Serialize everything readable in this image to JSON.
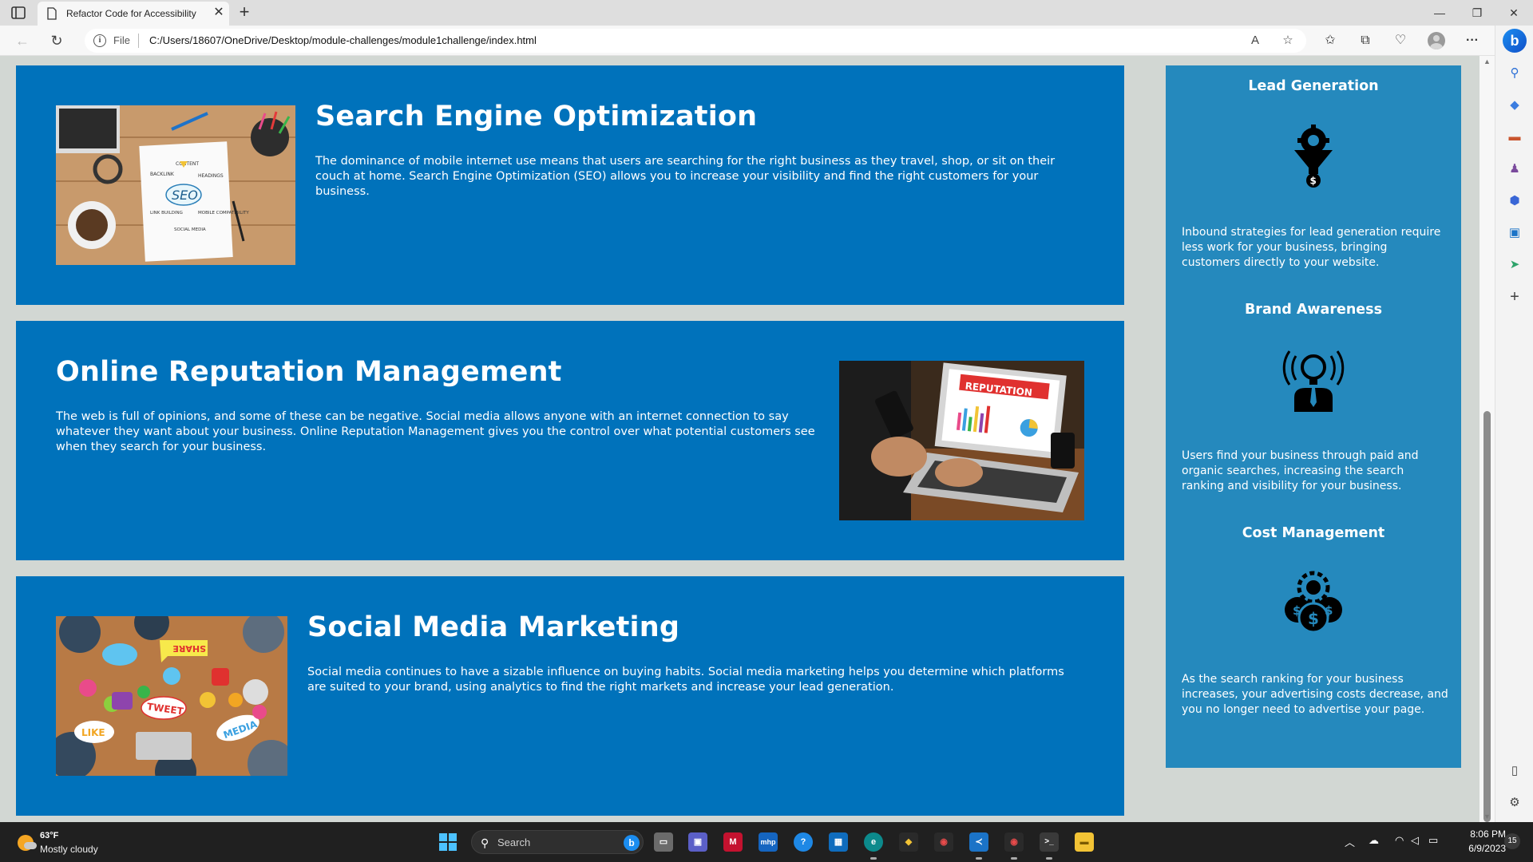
{
  "browser": {
    "tab_title": "Refactor Code for Accessibility",
    "url_scheme": "File",
    "url": "C:/Users/18607/OneDrive/Desktop/module-challenges/module1challenge/index.html",
    "bing_label": "b"
  },
  "content": [
    {
      "title": "Search Engine Optimization",
      "text": "The dominance of mobile internet use means that users are searching for the right business as they travel, shop, or sit on their couch at home. Search Engine Optimization (SEO) allows you to increase your visibility and find the right customers for your business.",
      "image_words": [
        "CONTENT",
        "BACKLINK",
        "HEADINGS",
        "SEO",
        "LINK BUILDING",
        "MOBILE COMPATIBILITY",
        "SOCIAL MEDIA"
      ]
    },
    {
      "title": "Online Reputation Management",
      "text": "The web is full of opinions, and some of these can be negative. Social media allows anyone with an internet connection to say whatever they want about your business. Online Reputation Management gives you the control over what potential customers see when they search for your business.",
      "image_words": [
        "REPUTATION"
      ]
    },
    {
      "title": "Social Media Marketing",
      "text": "Social media continues to have a sizable influence on buying habits. Social media marketing helps you determine which platforms are suited to your brand, using analytics to find the right markets and increase your lead generation.",
      "image_words": [
        "SHARE",
        "TWEET",
        "LIKE",
        "MEDIA"
      ]
    }
  ],
  "benefits": [
    {
      "title": "Lead Generation",
      "icon": "lead-funnel-icon",
      "text": "Inbound strategies for lead generation require less work for your business, bringing customers directly to your website."
    },
    {
      "title": "Brand Awareness",
      "icon": "brand-lightbulb-icon",
      "text": "Users find your business through paid and organic searches, increasing the search ranking and visibility for your business."
    },
    {
      "title": "Cost Management",
      "icon": "cost-coins-icon",
      "text": "As the search ranking for your business increases, your advertising costs decrease, and you no longer need to advertise your page."
    }
  ],
  "taskbar": {
    "temperature": "63°F",
    "weather": "Mostly cloudy",
    "search_placeholder": "Search",
    "time": "8:06 PM",
    "date": "6/9/2023",
    "notification_count": "15"
  },
  "colors": {
    "content_card": "#0072bb",
    "benefits_panel": "#2589bd",
    "page_background": "#d2d7d3"
  }
}
